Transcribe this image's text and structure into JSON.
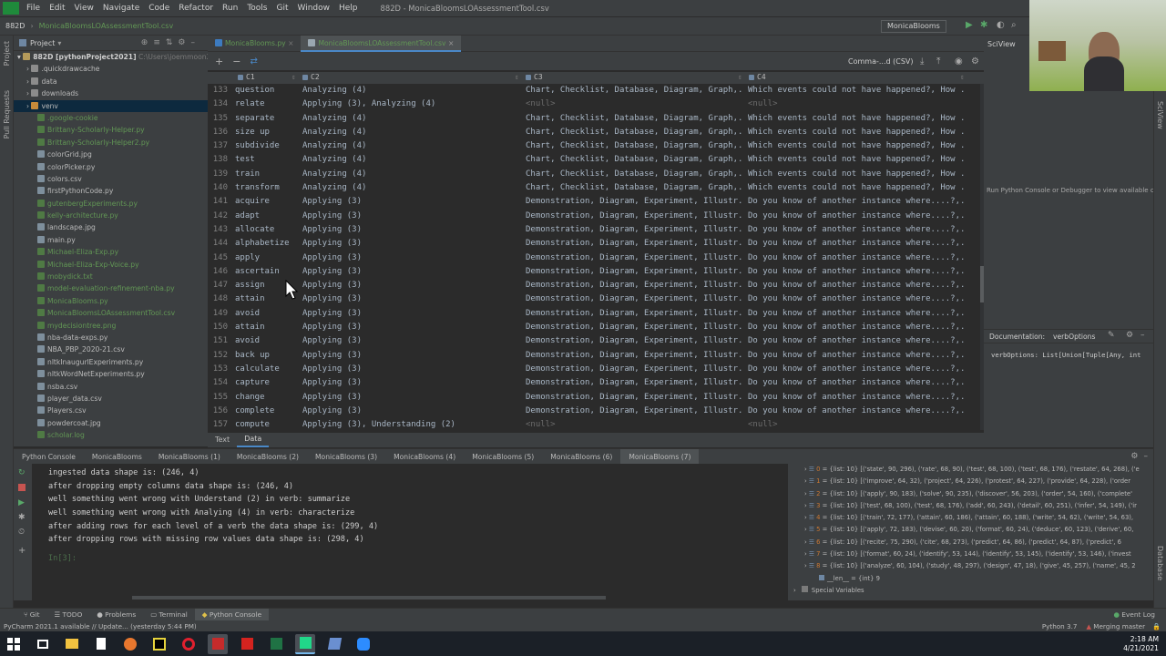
{
  "menubar": {
    "items": [
      "File",
      "Edit",
      "View",
      "Navigate",
      "Code",
      "Refactor",
      "Run",
      "Tools",
      "Git",
      "Window",
      "Help"
    ],
    "window_title": "882D - MonicaBloomsLOAssessmentTool.csv"
  },
  "navbar": {
    "project": "882D",
    "file": "MonicaBloomsLOAssessmentTool.csv",
    "run_config": "MonicaBlooms"
  },
  "project_panel": {
    "title": "Project",
    "root": "882D [pythonProject2021]",
    "root_path": "C:\\Users\\joemmoon2\\D...",
    "items": [
      {
        "label": ".quickdrawcache",
        "type": "folder"
      },
      {
        "label": "data",
        "type": "folder"
      },
      {
        "label": "downloads",
        "type": "folder"
      },
      {
        "label": "venv",
        "type": "folder-sel"
      },
      {
        "label": ".google-cookie",
        "type": "green"
      },
      {
        "label": "Brittany-Scholarly-Helper.py",
        "type": "green"
      },
      {
        "label": "Brittany-Scholarly-Helper2.py",
        "type": "green"
      },
      {
        "label": "colorGrid.jpg",
        "type": "file"
      },
      {
        "label": "colorPicker.py",
        "type": "file"
      },
      {
        "label": "colors.csv",
        "type": "file"
      },
      {
        "label": "firstPythonCode.py",
        "type": "file"
      },
      {
        "label": "gutenbergExperiments.py",
        "type": "green"
      },
      {
        "label": "kelly-architecture.py",
        "type": "green"
      },
      {
        "label": "landscape.jpg",
        "type": "file"
      },
      {
        "label": "main.py",
        "type": "file"
      },
      {
        "label": "Michael-Eliza-Exp.py",
        "type": "green"
      },
      {
        "label": "Michael-Eliza-Exp-Voice.py",
        "type": "green"
      },
      {
        "label": "mobydick.txt",
        "type": "green"
      },
      {
        "label": "model-evaluation-refinement-nba.py",
        "type": "green"
      },
      {
        "label": "MonicaBlooms.py",
        "type": "green"
      },
      {
        "label": "MonicaBloomsLOAssessmentTool.csv",
        "type": "green"
      },
      {
        "label": "mydecisiontree.png",
        "type": "green"
      },
      {
        "label": "nba-data-exps.py",
        "type": "file"
      },
      {
        "label": "NBA_PBP_2020-21.csv",
        "type": "file"
      },
      {
        "label": "nltkInaugurlExperiments.py",
        "type": "file"
      },
      {
        "label": "nltkWordNetExperiments.py",
        "type": "file"
      },
      {
        "label": "nsba.csv",
        "type": "file"
      },
      {
        "label": "player_data.csv",
        "type": "file"
      },
      {
        "label": "Players.csv",
        "type": "file"
      },
      {
        "label": "powdercoat.jpg",
        "type": "file"
      },
      {
        "label": "scholar.log",
        "type": "green"
      }
    ]
  },
  "editor_tabs": [
    {
      "label": "MonicaBlooms.py",
      "active": false
    },
    {
      "label": "MonicaBloomsLOAssessmentTool.csv",
      "active": true
    }
  ],
  "data_view": {
    "format_label": "Comma-...d (CSV)",
    "columns": [
      "C1",
      "C2",
      "C3",
      "C4"
    ],
    "rows": [
      [
        "133",
        "question",
        "Analyzing (4)",
        "Chart, Checklist, Database, Diagram, Graph,...",
        "Which events could not have happened?, How ..."
      ],
      [
        "134",
        "relate",
        "Applying (3), Analyzing (4)",
        "<null>",
        "<null>"
      ],
      [
        "135",
        "separate",
        "Analyzing (4)",
        "Chart, Checklist, Database, Diagram, Graph,...",
        "Which events could not have happened?, How ..."
      ],
      [
        "136",
        "size up",
        "Analyzing (4)",
        "Chart, Checklist, Database, Diagram, Graph,...",
        "Which events could not have happened?, How ..."
      ],
      [
        "137",
        "subdivide",
        "Analyzing (4)",
        "Chart, Checklist, Database, Diagram, Graph,...",
        "Which events could not have happened?, How ..."
      ],
      [
        "138",
        "test",
        "Analyzing (4)",
        "Chart, Checklist, Database, Diagram, Graph,...",
        "Which events could not have happened?, How ..."
      ],
      [
        "139",
        "train",
        "Analyzing (4)",
        "Chart, Checklist, Database, Diagram, Graph,...",
        "Which events could not have happened?, How ..."
      ],
      [
        "140",
        "transform",
        "Analyzing (4)",
        "Chart, Checklist, Database, Diagram, Graph,...",
        "Which events could not have happened?, How ..."
      ],
      [
        "141",
        "acquire",
        "Applying (3)",
        "Demonstration, Diagram, Experiment, Illustr...",
        "Do you know of another instance where....?,..."
      ],
      [
        "142",
        "adapt",
        "Applying (3)",
        "Demonstration, Diagram, Experiment, Illustr...",
        "Do you know of another instance where....?,..."
      ],
      [
        "143",
        "allocate",
        "Applying (3)",
        "Demonstration, Diagram, Experiment, Illustr...",
        "Do you know of another instance where....?,..."
      ],
      [
        "144",
        "alphabetize",
        "Applying (3)",
        "Demonstration, Diagram, Experiment, Illustr...",
        "Do you know of another instance where....?,..."
      ],
      [
        "145",
        "apply",
        "Applying (3)",
        "Demonstration, Diagram, Experiment, Illustr...",
        "Do you know of another instance where....?,..."
      ],
      [
        "146",
        "ascertain",
        "Applying (3)",
        "Demonstration, Diagram, Experiment, Illustr...",
        "Do you know of another instance where....?,..."
      ],
      [
        "147",
        "assign",
        "Applying (3)",
        "Demonstration, Diagram, Experiment, Illustr...",
        "Do you know of another instance where....?,..."
      ],
      [
        "148",
        "attain",
        "Applying (3)",
        "Demonstration, Diagram, Experiment, Illustr...",
        "Do you know of another instance where....?,..."
      ],
      [
        "149",
        "avoid",
        "Applying (3)",
        "Demonstration, Diagram, Experiment, Illustr...",
        "Do you know of another instance where....?,..."
      ],
      [
        "150",
        "attain",
        "Applying (3)",
        "Demonstration, Diagram, Experiment, Illustr...",
        "Do you know of another instance where....?,..."
      ],
      [
        "151",
        "avoid",
        "Applying (3)",
        "Demonstration, Diagram, Experiment, Illustr...",
        "Do you know of another instance where....?,..."
      ],
      [
        "152",
        "back up",
        "Applying (3)",
        "Demonstration, Diagram, Experiment, Illustr...",
        "Do you know of another instance where....?,..."
      ],
      [
        "153",
        "calculate",
        "Applying (3)",
        "Demonstration, Diagram, Experiment, Illustr...",
        "Do you know of another instance where....?,..."
      ],
      [
        "154",
        "capture",
        "Applying (3)",
        "Demonstration, Diagram, Experiment, Illustr...",
        "Do you know of another instance where....?,..."
      ],
      [
        "155",
        "change",
        "Applying (3)",
        "Demonstration, Diagram, Experiment, Illustr...",
        "Do you know of another instance where....?,..."
      ],
      [
        "156",
        "complete",
        "Applying (3)",
        "Demonstration, Diagram, Experiment, Illustr...",
        "Do you know of another instance where....?,..."
      ],
      [
        "157",
        "compute",
        "Applying (3), Understanding (2)",
        "<null>",
        "<null>"
      ]
    ],
    "bottom_tabs": [
      "Text",
      "Data"
    ]
  },
  "right_panel": {
    "sciview": "SciView",
    "hint": "Run Python Console or Debugger to view available c...",
    "doc_label": "Documentation:",
    "doc_tab": "verbOptions",
    "doc_sig": "verbOptions: List[Union[Tuple[Any, int"
  },
  "console_tabs": [
    "Python Console",
    "MonicaBlooms",
    "MonicaBlooms (1)",
    "MonicaBlooms (2)",
    "MonicaBlooms (3)",
    "MonicaBlooms (4)",
    "MonicaBlooms (5)",
    "MonicaBlooms (6)",
    "MonicaBlooms (7)"
  ],
  "console_lines": [
    "ingested data shape is: (246, 4)",
    "after dropping empty columns data shape is: (246, 4)",
    "well something went wrong with Understand (2) in verb: summarize",
    "well something went wrong with Analying (4) in verb: characterize",
    "after adding rows for each level of a verb the data shape is: (299, 4)",
    "after dropping rows with missing row values data shape is: (298, 4)"
  ],
  "console_prompt": "In[3]:",
  "variables": [
    {
      "idx": "0",
      "text": "{list: 10} [('state', 90, 296), ('rate', 68, 90), ('test', 68, 100), ('test', 68, 176), ('restate', 64, 268), ('e"
    },
    {
      "idx": "1",
      "text": "{list: 10} [('improve', 64, 32), ('project', 64, 226), ('protest', 64, 227), ('provide', 64, 228), ('order"
    },
    {
      "idx": "2",
      "text": "{list: 10} [('apply', 90, 183), ('solve', 90, 235), ('discover', 56, 203), ('order', 54, 160), ('complete'"
    },
    {
      "idx": "3",
      "text": "{list: 10} [('test', 68, 100), ('test', 68, 176), ('add', 60, 243), ('detail', 60, 251), ('infer', 54, 149), ('ir"
    },
    {
      "idx": "4",
      "text": "{list: 10} [('train', 72, 177), ('attain', 60, 186), ('attain', 60, 188), ('write', 54, 62), ('write', 54, 63),"
    },
    {
      "idx": "5",
      "text": "{list: 10} [('apply', 72, 183), ('devise', 60, 20), ('format', 60, 24), ('deduce', 60, 123), ('derive', 60,"
    },
    {
      "idx": "6",
      "text": "{list: 10} [('recite', 75, 290), ('cite', 68, 273), ('predict', 64, 86), ('predict', 64, 87), ('predict', 6"
    },
    {
      "idx": "7",
      "text": "{list: 10} [('format', 60, 24), ('identify', 53, 144), ('identify', 53, 145), ('identify', 53, 146), ('invest"
    },
    {
      "idx": "8",
      "text": "{list: 10} [('analyze', 60, 104), ('study', 48, 297), ('design', 47, 18), ('give', 45, 257), ('name', 45, 2"
    }
  ],
  "vars_len": "__len__ = {int} 9",
  "special_vars": "Special Variables",
  "bottom_tools": [
    "Git",
    "TODO",
    "Problems",
    "Terminal",
    "Python Console"
  ],
  "event_log": "Event Log",
  "status": {
    "left": "PyCharm 2021.1 available // Update... (yesterday 5:44 PM)",
    "python": "Python 3.7",
    "git": "Merging master"
  },
  "clock": {
    "time": "2:18 AM",
    "date": "4/21/2021"
  }
}
